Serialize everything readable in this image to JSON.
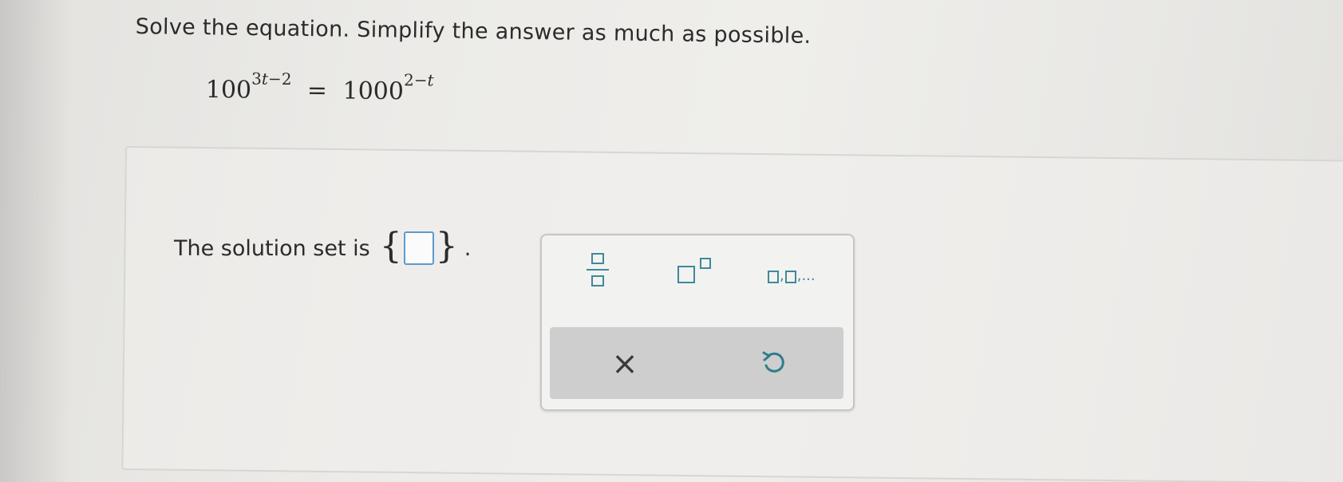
{
  "question": {
    "prompt": "Solve the equation. Simplify the answer as much as possible.",
    "equation": {
      "lhs_base": "100",
      "lhs_exponent_coef": "3",
      "lhs_exponent_var": "t",
      "lhs_exponent_rest": "−2",
      "equals": "=",
      "rhs_base": "1000",
      "rhs_exponent_const": "2−",
      "rhs_exponent_var": "t"
    }
  },
  "answer": {
    "label": "The solution set is",
    "brace_open": "{",
    "brace_close": "}",
    "period": ".",
    "value": ""
  },
  "keypad": {
    "tools": [
      {
        "name": "fraction-icon"
      },
      {
        "name": "exponent-icon"
      },
      {
        "name": "list-icon",
        "separator": ",",
        "ellipsis": ",..."
      }
    ],
    "clear_label": "×",
    "undo_icon": "undo-icon"
  }
}
